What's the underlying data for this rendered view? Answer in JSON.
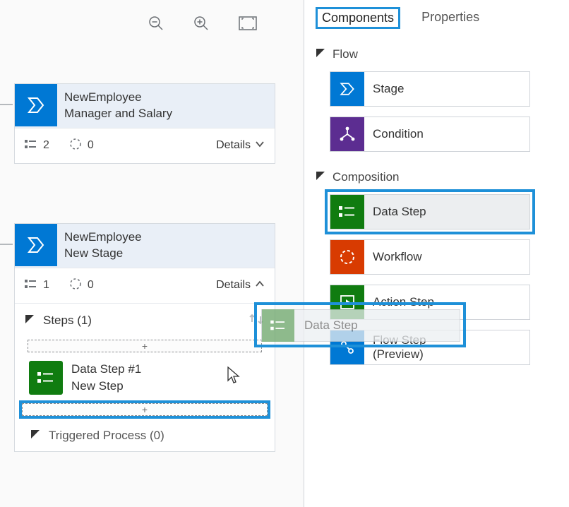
{
  "canvas": {
    "stage1": {
      "title": "NewEmployee",
      "subtitle": "Manager and Salary",
      "step_count": "2",
      "wf_count": "0",
      "details_label": "Details"
    },
    "stage2": {
      "title": "NewEmployee",
      "subtitle": "New Stage",
      "step_count": "1",
      "wf_count": "0",
      "details_label": "Details",
      "steps_header": "Steps (1)",
      "dropzone_label": "+",
      "data_step_title": "Data Step #1",
      "data_step_sub": "New Step",
      "triggered_label": "Triggered Process (0)"
    }
  },
  "panel": {
    "tabs": {
      "components": "Components",
      "properties": "Properties"
    },
    "sections": {
      "flow": "Flow",
      "composition": "Composition"
    },
    "items": {
      "stage": "Stage",
      "condition": "Condition",
      "data_step": "Data Step",
      "workflow": "Workflow",
      "action_step": "Action Step",
      "flow_step_l1": "Flow Step",
      "flow_step_l2": "(Preview)"
    }
  },
  "drag": {
    "label": "Data Step"
  }
}
